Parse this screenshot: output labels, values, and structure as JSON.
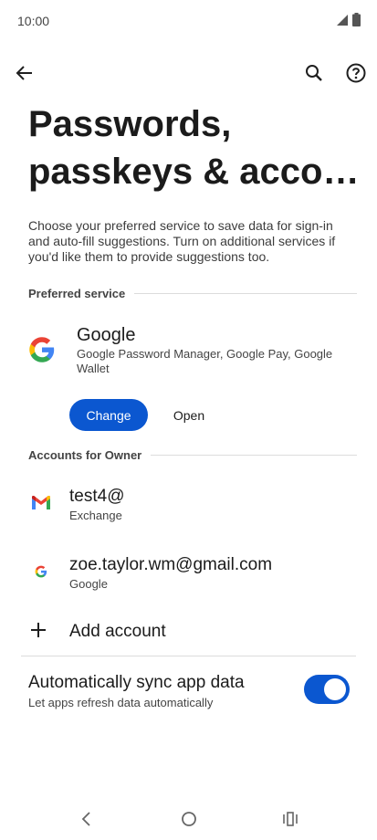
{
  "status_bar": {
    "time": "10:00"
  },
  "header": {
    "back_icon": "arrow-back-icon",
    "search_icon": "search-icon",
    "help_icon": "help-icon"
  },
  "page": {
    "title_line1": "Passwords,",
    "title_line2": "passkeys & acco…",
    "intro": "Choose your preferred service to save data for sign-in and auto-fill suggestions. Turn on additional services if you'd like them to provide suggestions too."
  },
  "preferred_service": {
    "header": "Preferred service",
    "name": "Google",
    "description": "Google Password Manager, Google Pay, Google Wallet",
    "change_label": "Change",
    "open_label": "Open"
  },
  "accounts": {
    "header": "Accounts for Owner",
    "items": [
      {
        "name": "test4@",
        "type": "Exchange",
        "icon": "gmail-icon"
      },
      {
        "name": "zoe.taylor.wm@gmail.com",
        "type": "Google",
        "icon": "google-icon"
      }
    ],
    "add_label": "Add account"
  },
  "sync": {
    "title": "Automatically sync app data",
    "subtitle": "Let apps refresh data automatically",
    "enabled": true
  },
  "colors": {
    "accent": "#0b57d0",
    "google_blue": "#4285F4",
    "google_red": "#EA4335",
    "google_yellow": "#FBBC05",
    "google_green": "#34A853"
  }
}
